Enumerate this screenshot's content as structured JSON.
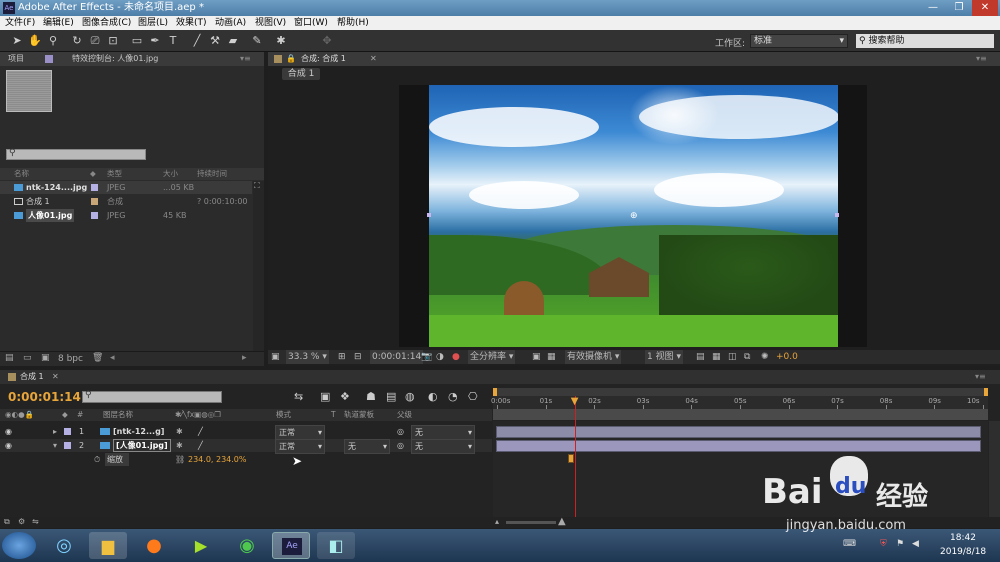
{
  "window": {
    "title": "Adobe After Effects - 未命名项目.aep *",
    "app_icon": "Ae"
  },
  "menu": [
    "文件(F)",
    "编辑(E)",
    "图像合成(C)",
    "图层(L)",
    "效果(T)",
    "动画(A)",
    "视图(V)",
    "窗口(W)",
    "帮助(H)"
  ],
  "toolbar": {
    "workspace_label": "工作区:",
    "workspace_value": "标准",
    "search_placeholder": "搜索帮助"
  },
  "project_panel": {
    "tab_project": "项目",
    "tab_effects": "特效控制台: 人像01.jpg",
    "columns": {
      "name": "名称",
      "type": "类型",
      "size": "大小",
      "duration": "持续时间"
    },
    "items": [
      {
        "name": "ntk-124....jpg",
        "type": "JPEG",
        "size": "...05 KB",
        "duration": ""
      },
      {
        "name": "合成 1",
        "type": "合成",
        "size": "",
        "duration": "? 0:00:10:00"
      },
      {
        "name": "人像01.jpg",
        "type": "JPEG",
        "size": "45 KB",
        "duration": ""
      }
    ],
    "bpc": "8 bpc"
  },
  "comp_panel": {
    "tab": "合成: 合成 1",
    "subtab": "合成 1",
    "zoom": "33.3 %",
    "timecode": "0:00:01:14",
    "resolution": "全分辨率",
    "camera": "有效摄像机",
    "views": "1 视图",
    "exposure": "+0.0"
  },
  "timeline": {
    "tab": "合成 1",
    "timecode": "0:00:01:14",
    "columns": {
      "layer_name": "图层名称",
      "mode": "模式",
      "t": "T",
      "track_matte": "轨道蒙板",
      "parent": "父级"
    },
    "ruler": [
      "0:00s",
      "01s",
      "02s",
      "03s",
      "04s",
      "05s",
      "06s",
      "07s",
      "08s",
      "09s",
      "10s"
    ],
    "playhead_fraction": 0.16,
    "layers": [
      {
        "num": "1",
        "name": "[ntk-12...g]",
        "mode": "正常",
        "matte": "",
        "parent": "无"
      },
      {
        "num": "2",
        "name": "[人像01.jpg]",
        "mode": "正常",
        "matte": "无",
        "parent": "无"
      }
    ],
    "property": {
      "name": "缩放",
      "value": "234.0, 234.0%"
    }
  },
  "taskbar": {
    "time": "18:42",
    "date": "2019/8/18"
  },
  "watermark": {
    "brand": "Bai",
    "brand2": "du",
    "cn": "经验",
    "url": "jingyan.baidu.com"
  },
  "colors": {
    "accent_orange": "#e8a53a",
    "playhead_red": "#d02020",
    "layer_bar": "#8c8ca8"
  }
}
